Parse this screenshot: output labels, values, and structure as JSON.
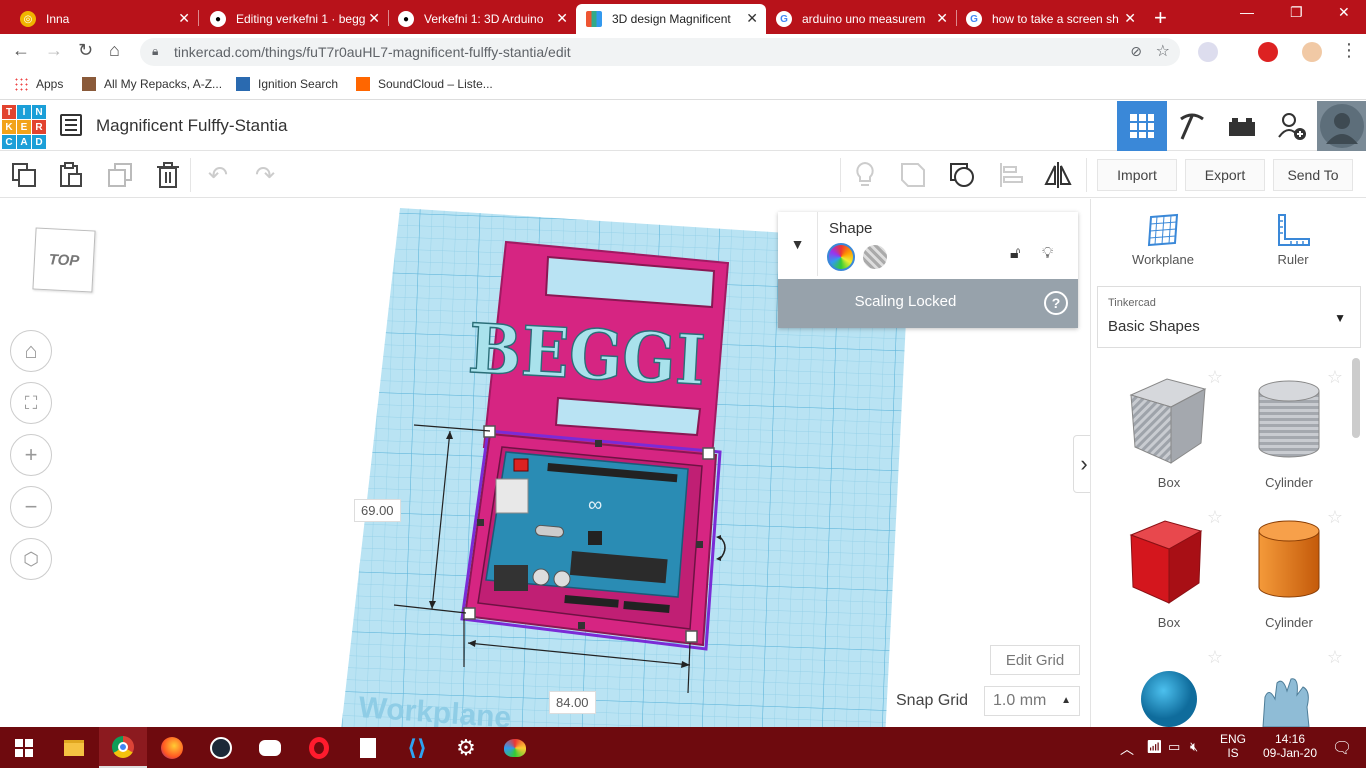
{
  "browser": {
    "tabs": [
      {
        "title": "Inna",
        "active": false
      },
      {
        "title": "Editing verkefni 1 · begg",
        "active": false
      },
      {
        "title": "Verkefni 1: 3D Arduino",
        "active": false
      },
      {
        "title": "3D design Magnificent",
        "active": true
      },
      {
        "title": "arduino uno measurem",
        "active": false
      },
      {
        "title": "how to take a screen sh",
        "active": false
      }
    ],
    "url": "tinkercad.com/things/fuT7r0auHL7-magnificent-fulffy-stantia/edit",
    "bookmarks": [
      "Apps",
      "All My Repacks, A-Z...",
      "Ignition Search",
      "SoundCloud – Liste..."
    ]
  },
  "app": {
    "logo_letters": [
      "T",
      "I",
      "N",
      "K",
      "E",
      "R",
      "C",
      "A",
      "D"
    ],
    "design_title": "Magnificent Fulffy-Stantia",
    "toolbar": {
      "import_label": "Import",
      "export_label": "Export",
      "sendto_label": "Send To"
    },
    "viewcube_label": "TOP",
    "canvas": {
      "beggi_text": "BEGGI",
      "dim_height": "69.00",
      "dim_width": "84.00",
      "workplane_watermark": "Workplane"
    },
    "inspector": {
      "title": "Shape",
      "locked_text": "Scaling Locked",
      "help": "?"
    },
    "edit_grid_label": "Edit Grid",
    "snap_grid_label": "Snap Grid",
    "snap_grid_value": "1.0 mm",
    "right_panel": {
      "workplane_label": "Workplane",
      "ruler_label": "Ruler",
      "library_source": "Tinkercad",
      "library_name": "Basic Shapes",
      "shapes": [
        {
          "label": "Box",
          "color": "#b0b4ba"
        },
        {
          "label": "Cylinder",
          "color": "#b0b4ba"
        },
        {
          "label": "Box",
          "color": "#d4161d"
        },
        {
          "label": "Cylinder",
          "color": "#e37014"
        },
        {
          "label": "",
          "color": "#1c96d1"
        },
        {
          "label": "",
          "color": "#7fb3cf"
        }
      ]
    }
  },
  "taskbar": {
    "lang_top": "ENG",
    "lang_bottom": "IS",
    "time": "14:16",
    "date": "09-Jan-20"
  },
  "colors": {
    "tabstrip": "#b8121a",
    "taskbar": "#6e0a0e",
    "workplane": "#a8dcef",
    "magenta": "#d62582",
    "selection": "#7b2bd6",
    "accent_blue": "#3a88d8"
  }
}
